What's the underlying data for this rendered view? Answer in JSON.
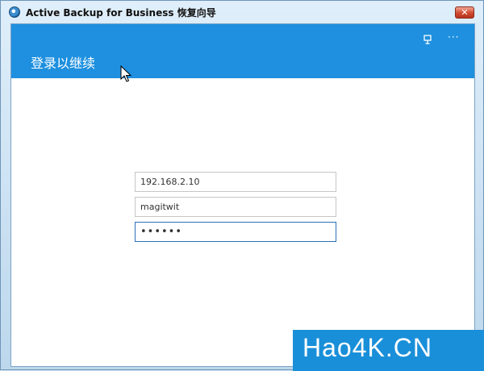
{
  "window": {
    "title": "Active Backup for Business 恢复向导",
    "close_glyph": "✕"
  },
  "header": {
    "title": "登录以继续",
    "more_glyph": "···",
    "icons": [
      "screen-icon",
      "more-icon"
    ],
    "color": "#1e90df"
  },
  "login": {
    "server": "192.168.2.10",
    "username": "magitwit",
    "password_masked": "••••••"
  },
  "watermark": {
    "text": "Hao4K.CN"
  }
}
